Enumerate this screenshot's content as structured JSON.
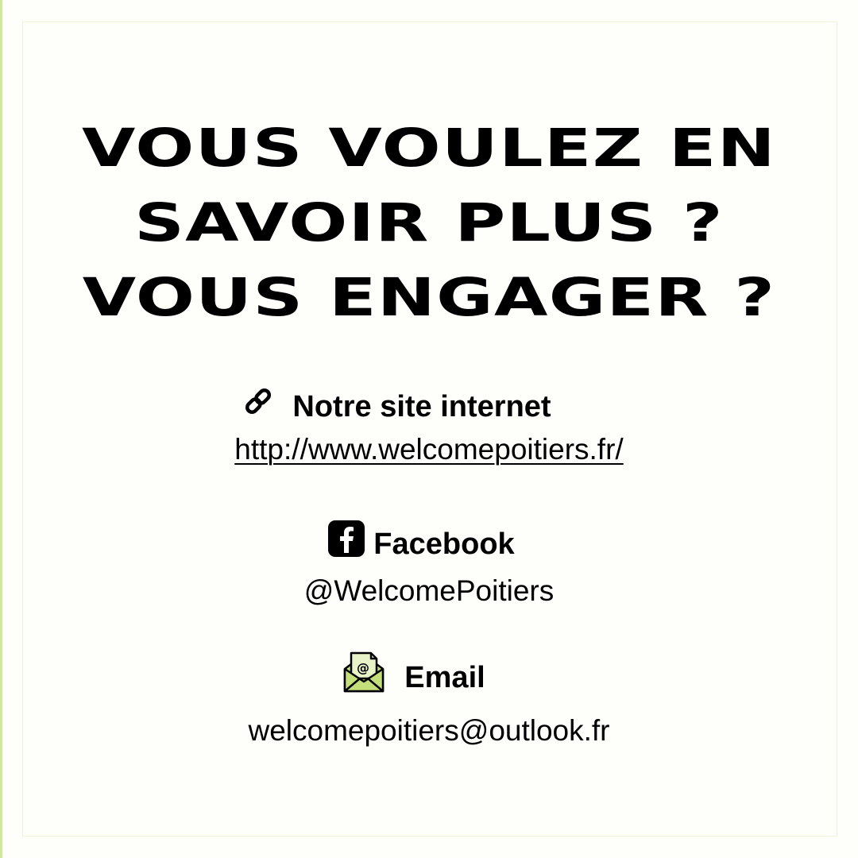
{
  "headline": {
    "lines": [
      "VOUS VOULEZ EN",
      "SAVOIR PLUS ?",
      "VOUS ENGAGER ?"
    ]
  },
  "contacts": {
    "website": {
      "icon": "link-icon",
      "heading": "Notre site internet",
      "value": "http://www.welcomepoitiers.fr/"
    },
    "facebook": {
      "icon": "facebook-icon",
      "heading": "Facebook",
      "value": "@WelcomePoitiers"
    },
    "email": {
      "icon": "email-envelope-icon",
      "heading": "Email",
      "value": "welcomepoitiers@outlook.fr"
    }
  },
  "colors": {
    "background": "#fefefb",
    "accent_green": "#cfe89a",
    "envelope_green": "#c4de7a",
    "text": "#000000"
  }
}
